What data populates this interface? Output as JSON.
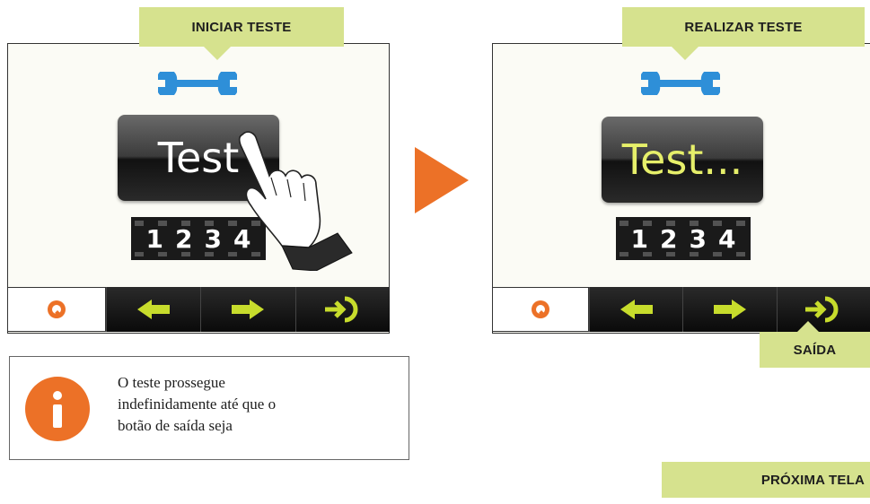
{
  "left_panel": {
    "callout": "INICIAR TESTE",
    "button_text": "Test",
    "counter_digits": [
      "1",
      "2",
      "3",
      "4"
    ]
  },
  "right_panel": {
    "callout": "REALIZAR TESTE",
    "button_text": "Test...",
    "counter_digits": [
      "1",
      "2",
      "3",
      "4"
    ],
    "exit_callout": "SAÍDA"
  },
  "info": {
    "text_line1": "O teste prossegue",
    "text_line2": "indefinidamente até que o",
    "text_line3": "botão de saída seja"
  },
  "next_screen": "PRÓXIMA TELA",
  "colors": {
    "callout": "#d6e28e",
    "accent_orange": "#ec7127",
    "wrench_blue": "#2e8fd8",
    "arrow_green": "#c7dc2c",
    "test_active_text": "#e6ef6a"
  }
}
